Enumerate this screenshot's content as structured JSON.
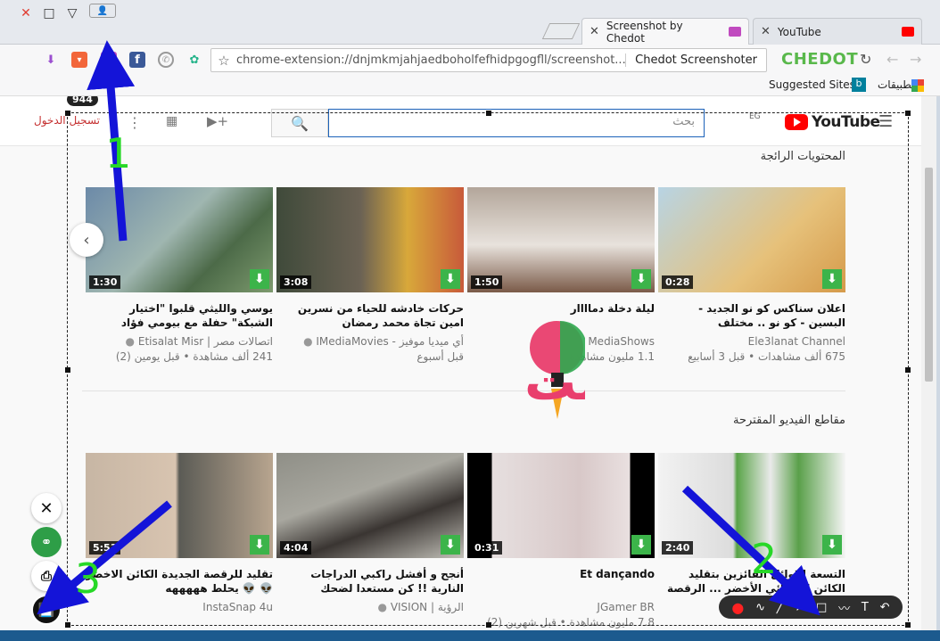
{
  "window": {
    "controls": {
      "close": "✕",
      "maximize": "□",
      "minimize": "▽"
    }
  },
  "tabs": [
    {
      "label": "Screenshot by Chedot",
      "icon": "screenshot-icon",
      "active": true
    },
    {
      "label": "YouTube",
      "icon": "youtube-icon",
      "active": false
    }
  ],
  "toolbar": {
    "url": "chrome-extension://dnjmkmjahjaedboholfefhidpgogfll/screenshot....",
    "chip": "Chedot Screenshoter",
    "brand": "CHEDOT"
  },
  "bookmarks": {
    "suggested": "Suggested Sites",
    "apps": "تطبيقات"
  },
  "youtube": {
    "logo": "YouTube",
    "region": "EG",
    "search_placeholder": "بحث",
    "signin": "تسجيل الدخول",
    "notif_count": "944"
  },
  "sections": [
    {
      "title": "المحتويات الرائجة",
      "videos": [
        {
          "title": "اعلان سناكس كو نو الجديد - البسين - كو نو .. مختلف",
          "channel": "Ele3lanat Channel",
          "meta": "675 ألف مشاهدات • قبل 3 أسابيع",
          "duration": "0:28",
          "verified": false
        },
        {
          "title": "ليلة دخلة دماااار",
          "channel": "MediaShows",
          "meta": "1.1 مليون مشاهدة",
          "duration": "1:50",
          "verified": false
        },
        {
          "title": "حركات خادشه للحياء من نسرين امين تجاة محمد رمضان",
          "channel": "أي ميديا موفيز - IMediaMovies",
          "meta": "قبل أسبوع",
          "duration": "3:08",
          "verified": true
        },
        {
          "title": "يوسي والليثي قلبوا \"اختيار الشبكة\" حفلة مع بيومي فؤاد",
          "channel": "اتصالات مصر | Etisalat Misr",
          "meta": "241 ألف مشاهدة • قبل يومين (2)",
          "duration": "1:30",
          "verified": true
        }
      ]
    },
    {
      "title": "مقاطع الفيديو المقترحة",
      "videos": [
        {
          "title": "التسعة الاوائل الفائزين بتقليد الكائن الفضائي الأخضر ... الرقصة المشهورة",
          "channel": "",
          "meta": "",
          "duration": "2:40",
          "verified": false
        },
        {
          "title": "Et dançando",
          "channel": "JGamer BR",
          "meta": "7.8 مليون مشاهدة • قبل شهرين (2)",
          "duration": "0:31",
          "verified": false
        },
        {
          "title": "أنجح و أفشل راكبي الدراجات النارية !! كن مستعدا لضحك",
          "channel": "الرؤية | VISION",
          "meta": "",
          "duration": "4:04",
          "verified": true
        },
        {
          "title": "تقليد للرقصة الجديدة الكائن الاخضر 👽 👽 يحلط هههههه",
          "channel": "InstaSnap 4u",
          "meta": "",
          "duration": "5:53",
          "verified": false
        }
      ]
    }
  ],
  "overlay": {
    "watermark": "تذكرة نت",
    "labels": [
      "1",
      "2",
      "3"
    ]
  },
  "colors": {
    "brand_green": "#59b84b",
    "youtube_red": "#ff0000",
    "download_green": "#3cb44a",
    "arrow_blue": "#1414d8",
    "label_green": "#27d827"
  }
}
